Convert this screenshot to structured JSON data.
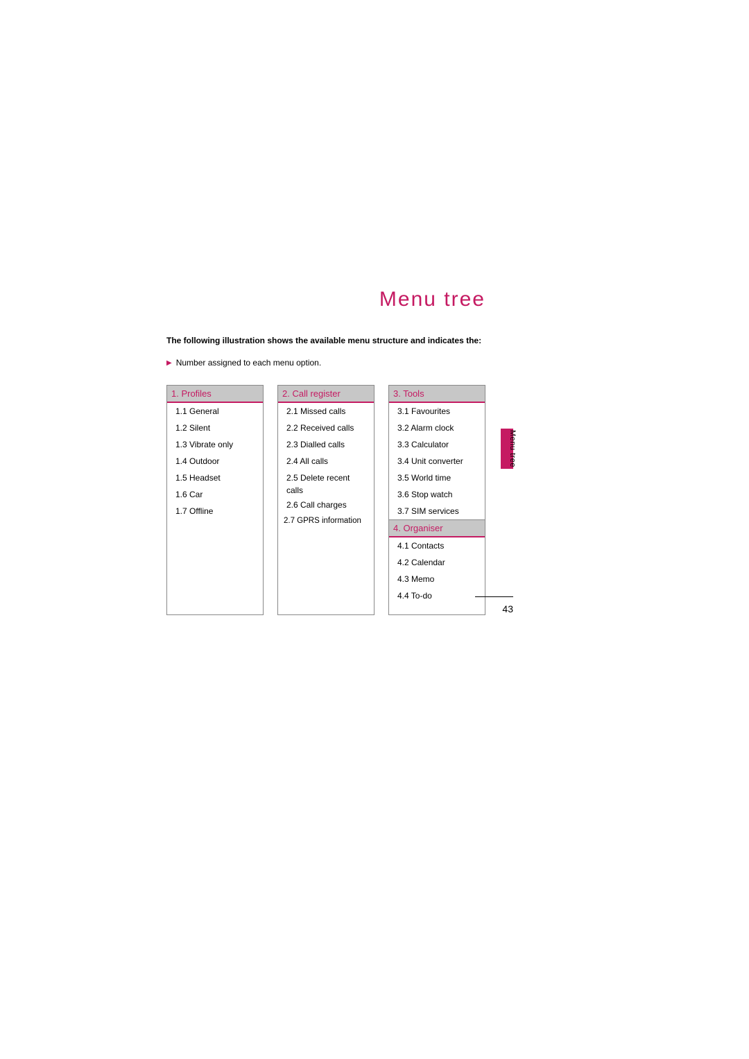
{
  "title": "Menu tree",
  "intro": "The following illustration shows the available menu structure and indicates the:",
  "bullet": "Number assigned to each menu option.",
  "side_label": "Menu tree",
  "page_number": "43",
  "columns": [
    {
      "sections": [
        {
          "header": "1. Profiles",
          "items": [
            "1.1 General",
            "1.2 Silent",
            "1.3 Vibrate only",
            "1.4 Outdoor",
            "1.5 Headset",
            "1.6 Car",
            "1.7 Offline"
          ]
        }
      ]
    },
    {
      "sections": [
        {
          "header": "2. Call register",
          "items": [
            "2.1 Missed calls",
            "2.2 Received calls",
            "2.3 Dialled calls",
            "2.4 All calls",
            "2.5 Delete recent calls",
            "2.6 Call charges",
            "2.7 GPRS information"
          ]
        }
      ]
    },
    {
      "sections": [
        {
          "header": "3. Tools",
          "items": [
            "3.1 Favourites",
            "3.2 Alarm clock",
            "3.3 Calculator",
            "3.4 Unit converter",
            "3.5 World time",
            "3.6 Stop watch",
            "3.7 SIM services"
          ]
        },
        {
          "header": "4. Organiser",
          "items": [
            "4.1 Contacts",
            "4.2 Calendar",
            "4.3 Memo",
            "4.4 To-do"
          ]
        }
      ]
    }
  ]
}
